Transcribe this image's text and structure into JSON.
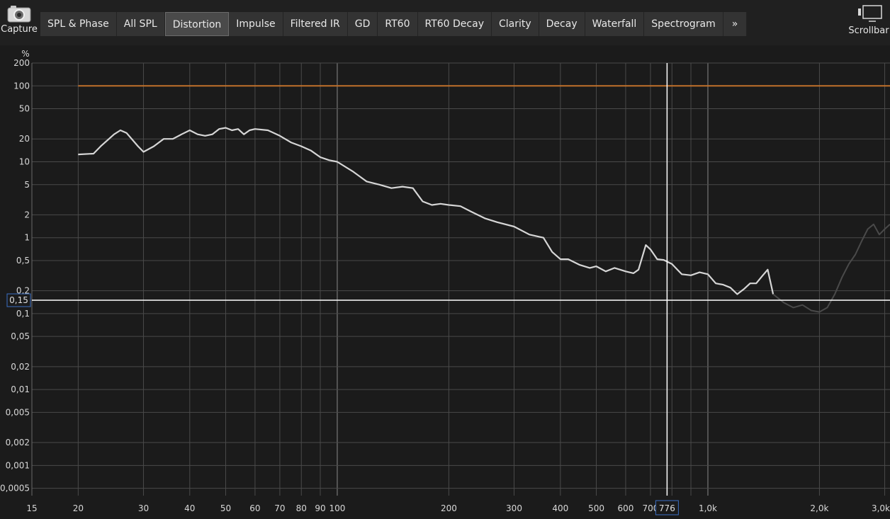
{
  "toolbar": {
    "capture_label": "Capture",
    "scrollbar_label": "Scrollbar",
    "more_label": "»",
    "tabs": [
      "SPL & Phase",
      "All SPL",
      "Distortion",
      "Impulse",
      "Filtered IR",
      "GD",
      "RT60",
      "RT60 Decay",
      "Clarity",
      "Decay",
      "Waterfall",
      "Spectrogram"
    ],
    "active_tab": "Distortion"
  },
  "colors": {
    "background": "#1b1b1b",
    "grid_major": "#8a8a8a",
    "grid_minor": "#4a4a4a",
    "trace": "#d6d6d6",
    "reference_line": "#c0702a",
    "cursor_line": "#ffffff",
    "cursor_box": "#3b6fc4"
  },
  "chart_data": {
    "type": "line",
    "title": "",
    "xlabel": "",
    "ylabel": "%",
    "x_scale": "log",
    "y_scale": "log",
    "xlim": [
      15,
      3100
    ],
    "ylim": [
      0.0004,
      200
    ],
    "grid": true,
    "x_tick_labels": [
      {
        "value": 15,
        "label": "15"
      },
      {
        "value": 20,
        "label": "20"
      },
      {
        "value": 30,
        "label": "30"
      },
      {
        "value": 40,
        "label": "40"
      },
      {
        "value": 50,
        "label": "50"
      },
      {
        "value": 60,
        "label": "60"
      },
      {
        "value": 70,
        "label": "70"
      },
      {
        "value": 80,
        "label": "80"
      },
      {
        "value": 90,
        "label": "90"
      },
      {
        "value": 100,
        "label": "100"
      },
      {
        "value": 200,
        "label": "200"
      },
      {
        "value": 300,
        "label": "300"
      },
      {
        "value": 400,
        "label": "400"
      },
      {
        "value": 500,
        "label": "500"
      },
      {
        "value": 600,
        "label": "600"
      },
      {
        "value": 700,
        "label": "700"
      },
      {
        "value": 1000,
        "label": "1,0k"
      },
      {
        "value": 2000,
        "label": "2,0k"
      },
      {
        "value": 3000,
        "label": "3,0k"
      }
    ],
    "y_tick_labels": [
      {
        "value": 200,
        "label": "200"
      },
      {
        "value": 100,
        "label": "100"
      },
      {
        "value": 50,
        "label": "50"
      },
      {
        "value": 20,
        "label": "20"
      },
      {
        "value": 10,
        "label": "10"
      },
      {
        "value": 5,
        "label": "5"
      },
      {
        "value": 2,
        "label": "2"
      },
      {
        "value": 1,
        "label": "1"
      },
      {
        "value": 0.5,
        "label": "0,5"
      },
      {
        "value": 0.2,
        "label": "0,2"
      },
      {
        "value": 0.1,
        "label": "0,1"
      },
      {
        "value": 0.05,
        "label": "0,05"
      },
      {
        "value": 0.02,
        "label": "0,02"
      },
      {
        "value": 0.01,
        "label": "0,01"
      },
      {
        "value": 0.005,
        "label": "0,005"
      },
      {
        "value": 0.002,
        "label": "0,002"
      },
      {
        "value": 0.001,
        "label": "0,001"
      },
      {
        "value": 0.0005,
        "label": "0,0005"
      }
    ],
    "reference_line": {
      "y": 100,
      "x_start": 20
    },
    "cursor": {
      "x": 776,
      "x_label": "776",
      "y": 0.15,
      "y_label": "0,15"
    },
    "series": [
      {
        "x": [
          20,
          22,
          23,
          25,
          26,
          27,
          29,
          30,
          32,
          34,
          36,
          38,
          40,
          42,
          44,
          46,
          48,
          50,
          52,
          54,
          56,
          58,
          60,
          65,
          70,
          75,
          80,
          85,
          90,
          95,
          100,
          110,
          120,
          130,
          140,
          150,
          160,
          170,
          180,
          190,
          200,
          215,
          230,
          250,
          270,
          300,
          330,
          360,
          380,
          400,
          420,
          450,
          480,
          500,
          530,
          560,
          600,
          630,
          650,
          680,
          700,
          730,
          760,
          800,
          850,
          900,
          950,
          1000,
          1050,
          1100,
          1150,
          1200,
          1250,
          1300,
          1350,
          1400,
          1450,
          1500
        ],
        "y": [
          12.5,
          12.8,
          16,
          23,
          26,
          24,
          16,
          13.5,
          16,
          20,
          20,
          23,
          26,
          23,
          22,
          23,
          27,
          28,
          26,
          27,
          23,
          26,
          27,
          26,
          22,
          18,
          16,
          14,
          11.5,
          10.5,
          10,
          7.5,
          5.5,
          5,
          4.5,
          4.7,
          4.5,
          3,
          2.7,
          2.8,
          2.7,
          2.6,
          2.2,
          1.8,
          1.6,
          1.4,
          1.1,
          1.0,
          0.65,
          0.52,
          0.52,
          0.44,
          0.4,
          0.42,
          0.36,
          0.4,
          0.36,
          0.34,
          0.38,
          0.8,
          0.7,
          0.52,
          0.51,
          0.45,
          0.33,
          0.32,
          0.35,
          0.33,
          0.25,
          0.24,
          0.22,
          0.18,
          0.21,
          0.25,
          0.25,
          0.31,
          0.38,
          0.18
        ]
      },
      {
        "faded": true,
        "x": [
          1500,
          1600,
          1700,
          1800,
          1900,
          2000,
          2100,
          2200,
          2300,
          2400,
          2500,
          2600,
          2700,
          2800,
          2900,
          3000,
          3100
        ],
        "y": [
          0.18,
          0.14,
          0.12,
          0.13,
          0.11,
          0.105,
          0.12,
          0.18,
          0.3,
          0.45,
          0.6,
          0.9,
          1.3,
          1.5,
          1.1,
          1.3,
          1.5
        ]
      }
    ]
  }
}
